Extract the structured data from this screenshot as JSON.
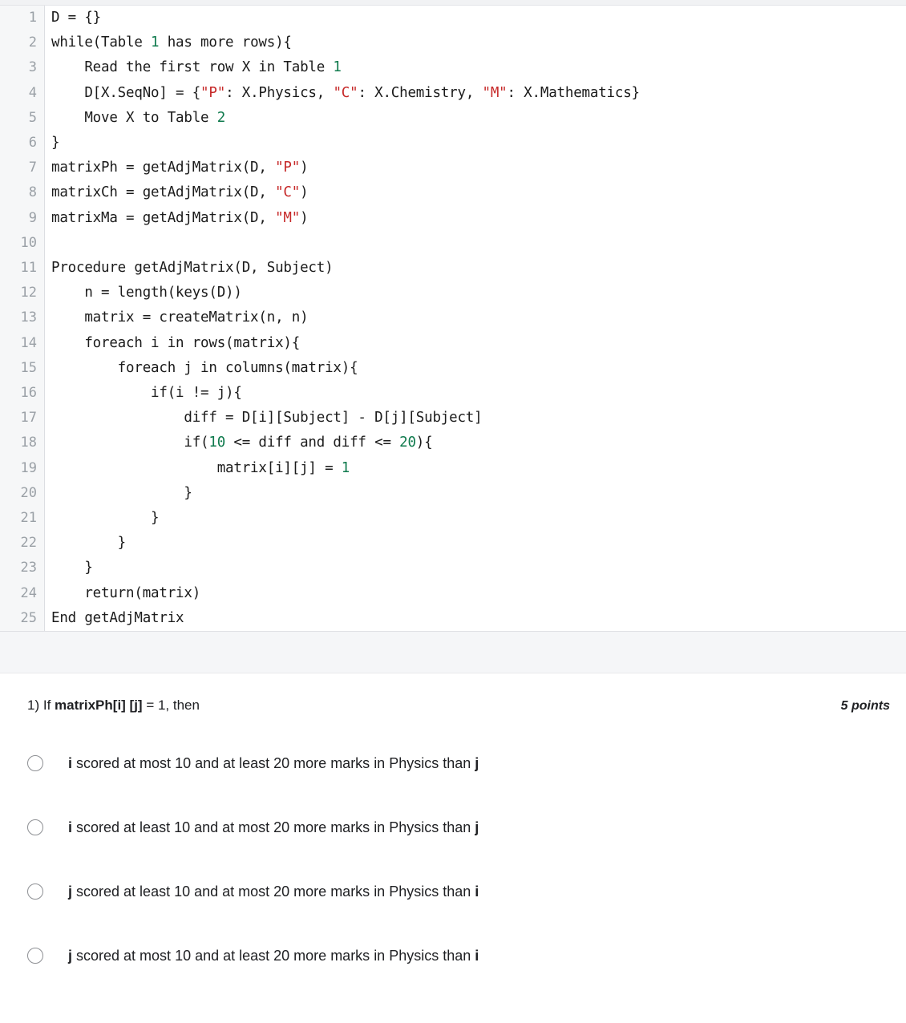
{
  "code": {
    "language": "pseudocode",
    "lines": [
      {
        "n": "1",
        "tokens": [
          {
            "t": "D = {}",
            "k": "plain"
          }
        ]
      },
      {
        "n": "2",
        "tokens": [
          {
            "t": "while(Table ",
            "k": "plain"
          },
          {
            "t": "1",
            "k": "num"
          },
          {
            "t": " has more rows){",
            "k": "plain"
          }
        ]
      },
      {
        "n": "3",
        "tokens": [
          {
            "t": "    Read the first row X in Table ",
            "k": "plain"
          },
          {
            "t": "1",
            "k": "num"
          }
        ]
      },
      {
        "n": "4",
        "tokens": [
          {
            "t": "    D[X.SeqNo] = {",
            "k": "plain"
          },
          {
            "t": "\"P\"",
            "k": "str"
          },
          {
            "t": ": X.Physics, ",
            "k": "plain"
          },
          {
            "t": "\"C\"",
            "k": "str"
          },
          {
            "t": ": X.Chemistry, ",
            "k": "plain"
          },
          {
            "t": "\"M\"",
            "k": "str"
          },
          {
            "t": ": X.Mathematics}",
            "k": "plain"
          }
        ]
      },
      {
        "n": "5",
        "tokens": [
          {
            "t": "    Move X to Table ",
            "k": "plain"
          },
          {
            "t": "2",
            "k": "num"
          }
        ]
      },
      {
        "n": "6",
        "tokens": [
          {
            "t": "}",
            "k": "plain"
          }
        ]
      },
      {
        "n": "7",
        "tokens": [
          {
            "t": "matrixPh = getAdjMatrix(D, ",
            "k": "plain"
          },
          {
            "t": "\"P\"",
            "k": "str"
          },
          {
            "t": ")",
            "k": "plain"
          }
        ]
      },
      {
        "n": "8",
        "tokens": [
          {
            "t": "matrixCh = getAdjMatrix(D, ",
            "k": "plain"
          },
          {
            "t": "\"C\"",
            "k": "str"
          },
          {
            "t": ")",
            "k": "plain"
          }
        ]
      },
      {
        "n": "9",
        "tokens": [
          {
            "t": "matrixMa = getAdjMatrix(D, ",
            "k": "plain"
          },
          {
            "t": "\"M\"",
            "k": "str"
          },
          {
            "t": ")",
            "k": "plain"
          }
        ]
      },
      {
        "n": "10",
        "tokens": [
          {
            "t": "",
            "k": "plain"
          }
        ]
      },
      {
        "n": "11",
        "tokens": [
          {
            "t": "Procedure getAdjMatrix(D, Subject)",
            "k": "plain"
          }
        ]
      },
      {
        "n": "12",
        "tokens": [
          {
            "t": "    n = length(keys(D))",
            "k": "plain"
          }
        ]
      },
      {
        "n": "13",
        "tokens": [
          {
            "t": "    matrix = createMatrix(n, n)",
            "k": "plain"
          }
        ]
      },
      {
        "n": "14",
        "tokens": [
          {
            "t": "    foreach i in rows(matrix){",
            "k": "plain"
          }
        ]
      },
      {
        "n": "15",
        "tokens": [
          {
            "t": "        foreach j in columns(matrix){",
            "k": "plain"
          }
        ]
      },
      {
        "n": "16",
        "tokens": [
          {
            "t": "            if(i != j){",
            "k": "plain"
          }
        ]
      },
      {
        "n": "17",
        "tokens": [
          {
            "t": "                diff = D[i][Subject] - D[j][Subject]",
            "k": "plain"
          }
        ]
      },
      {
        "n": "18",
        "tokens": [
          {
            "t": "                if(",
            "k": "plain"
          },
          {
            "t": "10",
            "k": "num"
          },
          {
            "t": " <= diff and diff <= ",
            "k": "plain"
          },
          {
            "t": "20",
            "k": "num"
          },
          {
            "t": "){",
            "k": "plain"
          }
        ]
      },
      {
        "n": "19",
        "tokens": [
          {
            "t": "                    matrix[i][j] = ",
            "k": "plain"
          },
          {
            "t": "1",
            "k": "num"
          }
        ]
      },
      {
        "n": "20",
        "tokens": [
          {
            "t": "                }",
            "k": "plain"
          }
        ]
      },
      {
        "n": "21",
        "tokens": [
          {
            "t": "            }",
            "k": "plain"
          }
        ]
      },
      {
        "n": "22",
        "tokens": [
          {
            "t": "        }",
            "k": "plain"
          }
        ]
      },
      {
        "n": "23",
        "tokens": [
          {
            "t": "    }",
            "k": "plain"
          }
        ]
      },
      {
        "n": "24",
        "tokens": [
          {
            "t": "    return(matrix)",
            "k": "plain"
          }
        ]
      },
      {
        "n": "25",
        "tokens": [
          {
            "t": "End getAdjMatrix",
            "k": "plain"
          }
        ]
      }
    ]
  },
  "question": {
    "number": "1)",
    "prefix": "If ",
    "bold_expr": "matrixPh[i] [j]",
    "suffix": " = 1, then",
    "points": "5 points",
    "options": [
      {
        "parts": [
          {
            "t": "i",
            "b": true
          },
          {
            "t": " scored at most 10 and at least 20 more marks in Physics than ",
            "b": false
          },
          {
            "t": "j",
            "b": true
          }
        ],
        "selected": false
      },
      {
        "parts": [
          {
            "t": "i",
            "b": true
          },
          {
            "t": " scored at least 10 and at most 20 more marks in Physics than ",
            "b": false
          },
          {
            "t": "j",
            "b": true
          }
        ],
        "selected": false
      },
      {
        "parts": [
          {
            "t": "j",
            "b": true
          },
          {
            "t": " scored at least 10 and at most 20 more marks in Physics than ",
            "b": false
          },
          {
            "t": "i",
            "b": true
          }
        ],
        "selected": false
      },
      {
        "parts": [
          {
            "t": "j",
            "b": true
          },
          {
            "t": " scored at most 10 and at least 20 more marks in Physics than ",
            "b": false
          },
          {
            "t": "i",
            "b": true
          }
        ],
        "selected": false
      }
    ]
  },
  "colors": {
    "string_token": "#c62828",
    "number_token": "#0f7a4d",
    "gutter_bg": "#f6f7f8",
    "gutter_text": "#9aa0a6",
    "page_bg": "#ffffff",
    "gap_bg": "#f5f6f8",
    "radio_border": "#8d8f93",
    "text": "#202124"
  }
}
